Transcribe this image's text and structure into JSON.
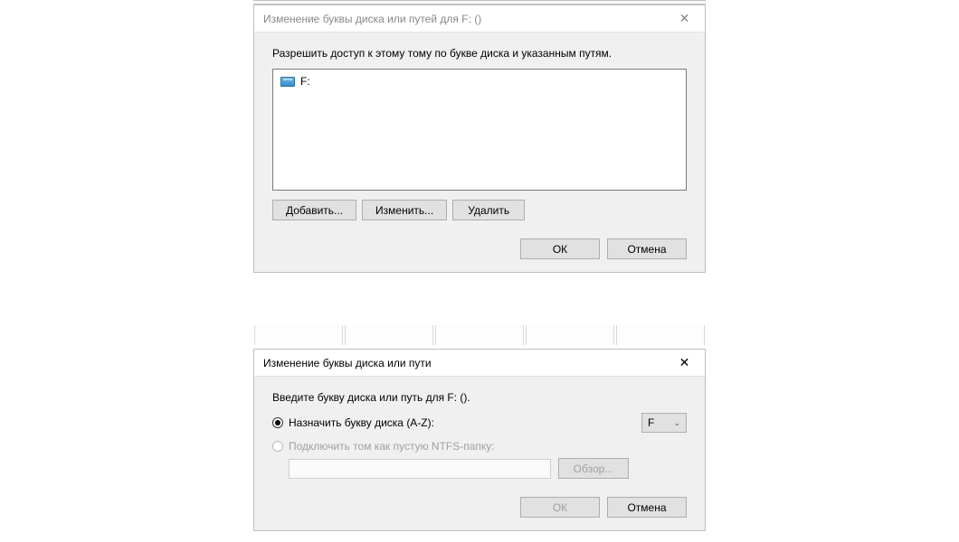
{
  "dialog1": {
    "title": "Изменение буквы диска или путей для F: ()",
    "instruction": "Разрешить доступ к этому тому по букве диска и указанным путям.",
    "drive_item": "F:",
    "add_label": "Добавить...",
    "change_label": "Изменить...",
    "delete_label": "Удалить",
    "ok_label": "ОК",
    "cancel_label": "Отмена"
  },
  "dialog2": {
    "title": "Изменение буквы диска или пути",
    "instruction": "Введите букву диска или путь для F: ().",
    "radio_assign": "Назначить букву диска (A-Z):",
    "radio_mount": "Подключить том как пустую NTFS-папку:",
    "selected_letter": "F",
    "browse_label": "Обзор...",
    "ok_label": "ОК",
    "cancel_label": "Отмена"
  }
}
